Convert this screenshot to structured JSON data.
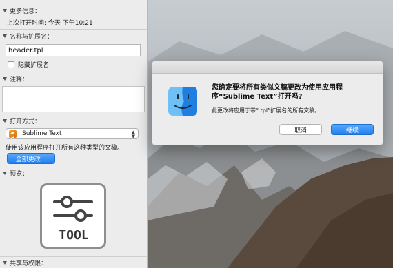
{
  "info_panel": {
    "more_info": {
      "header": "更多信息：",
      "last_opened": "上次打开时间: 今天 下午10:21"
    },
    "name_ext": {
      "header": "名称与扩展名：",
      "filename": "header.tpl",
      "hide_extension_label": "隐藏扩展名",
      "hide_extension_checked": false
    },
    "comments": {
      "header": "注释："
    },
    "open_with": {
      "header": "打开方式：",
      "selected_app": "Sublime Text",
      "app_icon": "sublime-text-icon",
      "description": "使用该应用程序打开所有这种类型的文稿。",
      "change_all_label": "全部更改..."
    },
    "preview": {
      "header": "预览：",
      "icon_label": "TOOL",
      "icon": "tool-sliders-icon"
    },
    "sharing": {
      "header": "共享与权限："
    }
  },
  "dialog": {
    "title_line1": "您确定要将所有类似文稿更改为使用应用程",
    "title_line2": "序“Sublime Text”打开吗?",
    "message": "此更改将应用于带“.tpl”扩展名的所有文稿。",
    "cancel_label": "取消",
    "continue_label": "继续",
    "icon": "finder-icon"
  },
  "colors": {
    "accent_blue": "#1f7ff0",
    "panel_bg": "#ececec"
  }
}
